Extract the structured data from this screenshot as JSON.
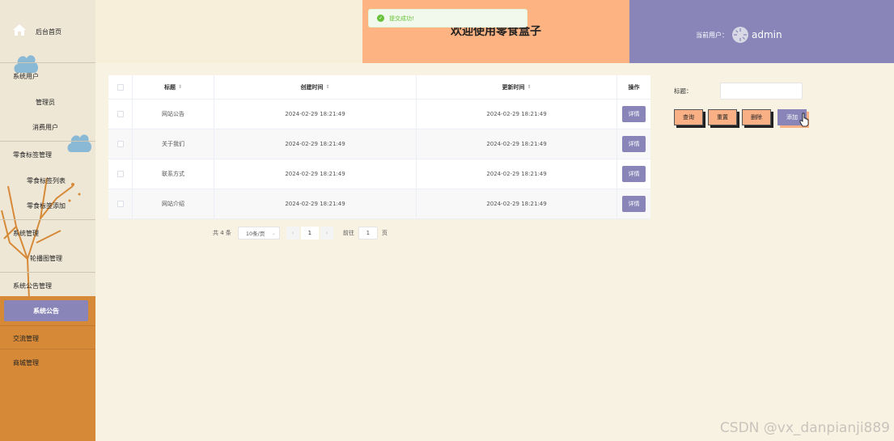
{
  "sidebar": {
    "home": "后台首页",
    "groups": [
      {
        "title": "系统用户",
        "items": [
          "管理员",
          "消费用户"
        ]
      },
      {
        "title": "零食标签管理",
        "items": [
          "零食标签列表",
          "零食标签添加"
        ]
      },
      {
        "title": "系统管理",
        "items": [
          "轮播图管理"
        ]
      },
      {
        "title": "系统公告管理",
        "items": [
          "系统公告"
        ]
      },
      {
        "title": "交流管理",
        "items": []
      },
      {
        "title": "商城管理",
        "items": []
      }
    ]
  },
  "header": {
    "title": "欢迎使用零食盒子",
    "user_label": "当前用户：",
    "user_name": "admin"
  },
  "toast": {
    "message": "提交成功!"
  },
  "table": {
    "columns": [
      "标题",
      "创建时间",
      "更新时间",
      "操作"
    ],
    "rows": [
      {
        "title": "网站公告",
        "created": "2024-02-29 18:21:49",
        "updated": "2024-02-29 18:21:49",
        "action": "详情"
      },
      {
        "title": "关于我们",
        "created": "2024-02-29 18:21:49",
        "updated": "2024-02-29 18:21:49",
        "action": "详情"
      },
      {
        "title": "联系方式",
        "created": "2024-02-29 18:21:49",
        "updated": "2024-02-29 18:21:49",
        "action": "详情"
      },
      {
        "title": "网站介绍",
        "created": "2024-02-29 18:21:49",
        "updated": "2024-02-29 18:21:49",
        "action": "详情"
      }
    ]
  },
  "pagination": {
    "total": "共 4 条",
    "page_size": "10条/页",
    "prev": "‹",
    "current": "1",
    "next": "›",
    "goto_label": "前往",
    "goto_value": "1",
    "page_suffix": "页"
  },
  "search": {
    "label": "标题：",
    "buttons": [
      "查询",
      "重置",
      "删除",
      "添加"
    ]
  },
  "watermark": "CSDN @vx_danpianji889",
  "colors": {
    "accent_purple": "#8a85b8",
    "accent_orange": "#fdb482",
    "sidebar_bottom": "#d68a38",
    "success": "#67c23a"
  }
}
